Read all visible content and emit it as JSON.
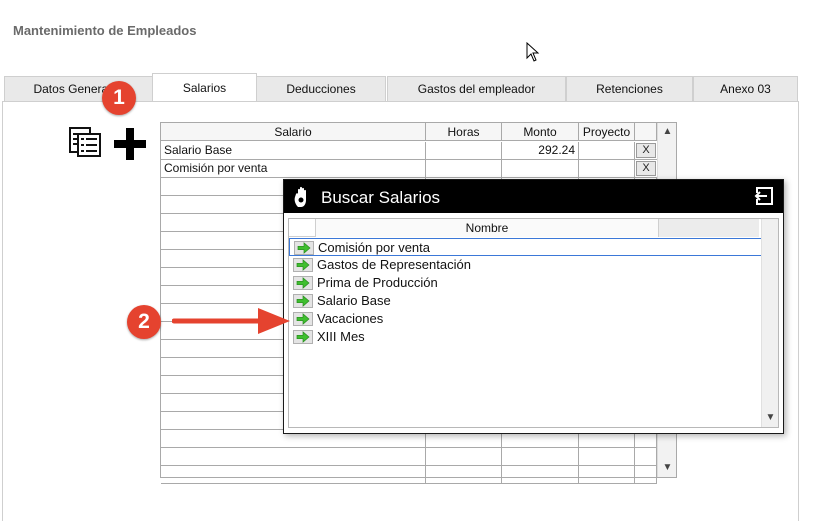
{
  "page": {
    "title": "Mantenimiento de Empleados"
  },
  "tabs": [
    {
      "label": "Datos Generales",
      "active": false
    },
    {
      "label": "Salarios",
      "active": true
    },
    {
      "label": "Deducciones",
      "active": false
    },
    {
      "label": "Gastos del empleador",
      "active": false
    },
    {
      "label": "Retenciones",
      "active": false
    },
    {
      "label": "Anexo 03",
      "active": false
    }
  ],
  "annotations": {
    "step1": "1",
    "step2": "2",
    "color": "#e5432f"
  },
  "toolbar": {
    "list_icon": "list-icon",
    "add_icon": "plus-icon"
  },
  "salary_grid": {
    "columns": [
      "Salario",
      "Horas",
      "Monto",
      "Proyecto"
    ],
    "rows": [
      {
        "salario": "Salario Base",
        "horas": "",
        "monto": "292.24",
        "proyecto": "",
        "delete": "X"
      },
      {
        "salario": "Comisión por venta",
        "horas": "",
        "monto": "",
        "proyecto": "",
        "delete": "X"
      }
    ]
  },
  "dialog": {
    "title": "Buscar Salarios",
    "column": "Nombre",
    "items": [
      "Comisión por venta",
      "Gastos de Representación",
      "Prima de Producción",
      "Salario Base",
      "Vacaciones",
      "XIII Mes"
    ],
    "selected_index": 0,
    "arrow_color": "#3fbf2f"
  }
}
